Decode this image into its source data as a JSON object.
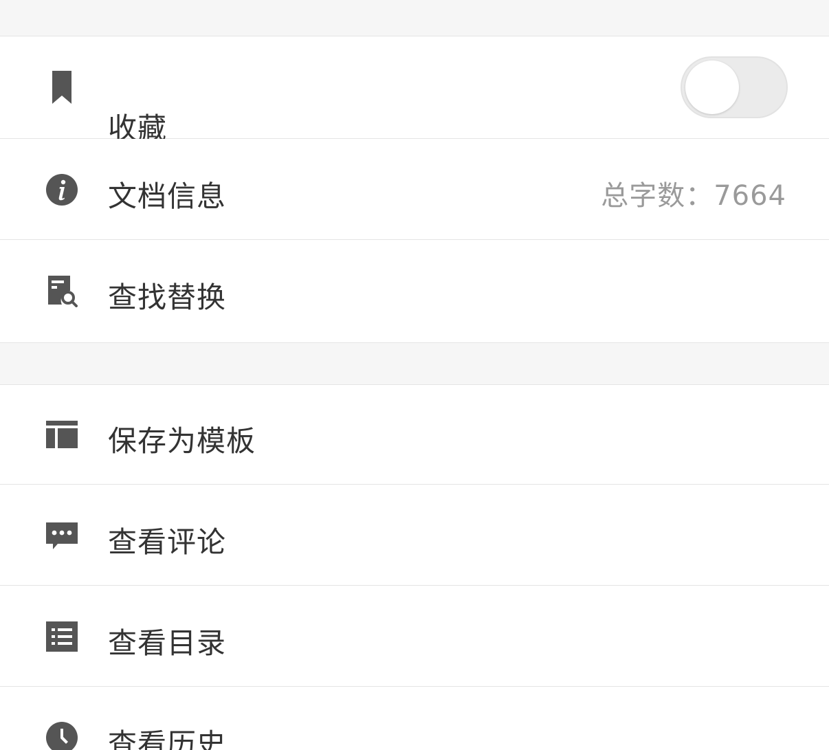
{
  "colors": {
    "icon": "#555555",
    "label": "#333333",
    "value": "#9a9a9a",
    "section_bg": "#f6f6f6",
    "divider": "#e4e4e4",
    "toggle_off": "#ebebeb"
  },
  "sections": [
    {
      "items": [
        {
          "icon": "bookmark-icon",
          "label": "收藏",
          "toggle": {
            "on": false
          }
        },
        {
          "icon": "info-icon",
          "label": "文档信息",
          "value": "总字数：7664"
        },
        {
          "icon": "find-replace-icon",
          "label": "查找替换"
        }
      ]
    },
    {
      "items": [
        {
          "icon": "template-icon",
          "label": "保存为模板"
        },
        {
          "icon": "comment-icon",
          "label": "查看评论"
        },
        {
          "icon": "toc-icon",
          "label": "查看目录"
        },
        {
          "icon": "history-clock-icon",
          "label": "查看历史"
        }
      ]
    }
  ]
}
